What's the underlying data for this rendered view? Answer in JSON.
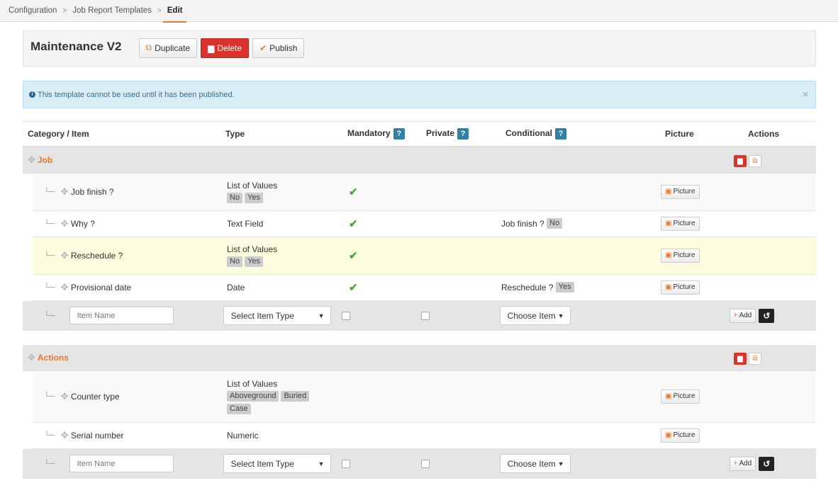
{
  "breadcrumb": {
    "item1": "Configuration",
    "item2": "Job Report Templates",
    "current": "Edit"
  },
  "header": {
    "title": "Maintenance V2",
    "duplicate": "Duplicate",
    "delete": "Delete",
    "publish": "Publish"
  },
  "alert": {
    "text": "This template cannot be used until it has been published.",
    "close": "×"
  },
  "columns": {
    "category": "Category / Item",
    "type": "Type",
    "mandatory": "Mandatory",
    "private": "Private",
    "conditional": "Conditional",
    "picture": "Picture",
    "actions": "Actions",
    "help": "?"
  },
  "sections": [
    {
      "name": "Job",
      "items": [
        {
          "name": "Job finish ?",
          "type": "List of Values",
          "values": [
            "No",
            "Yes"
          ],
          "mandatory": true,
          "cond_item": "",
          "cond_value": "",
          "picture": "Picture"
        },
        {
          "name": "Why ?",
          "type": "Text Field",
          "values": [],
          "mandatory": true,
          "cond_item": "Job finish ?",
          "cond_value": "No",
          "picture": "Picture"
        },
        {
          "name": "Reschedule ?",
          "type": "List of Values",
          "values": [
            "No",
            "Yes"
          ],
          "mandatory": true,
          "cond_item": "",
          "cond_value": "",
          "picture": "Picture"
        },
        {
          "name": "Provisional date",
          "type": "Date",
          "values": [],
          "mandatory": true,
          "cond_item": "Reschedule ?",
          "cond_value": "Yes",
          "picture": "Picture"
        }
      ],
      "add": {
        "placeholder": "Item Name",
        "type_select": "Select Item Type",
        "cond_select": "Choose Item",
        "add_label": "Add"
      }
    },
    {
      "name": "Actions",
      "items": [
        {
          "name": "Counter type",
          "type": "List of Values",
          "values": [
            "Aboveground",
            "Buried",
            "Case"
          ],
          "mandatory": false,
          "cond_item": "",
          "cond_value": "",
          "picture": "Picture"
        },
        {
          "name": "Serial number",
          "type": "Numeric",
          "values": [],
          "mandatory": false,
          "cond_item": "",
          "cond_value": "",
          "picture": "Picture"
        }
      ],
      "add": {
        "placeholder": "Item Name",
        "type_select": "Select Item Type",
        "cond_select": "Choose Item",
        "add_label": "Add"
      }
    }
  ],
  "colors": {
    "accent": "#e8782a",
    "danger": "#d9332b",
    "check": "#4ca83a",
    "info_bg": "#d8eef7",
    "help": "#317fa3"
  }
}
